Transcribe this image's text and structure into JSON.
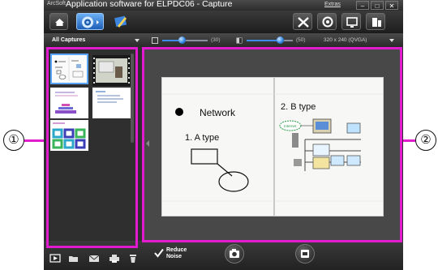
{
  "titlebar": {
    "brand": "ArcSoft",
    "title": "Application software for ELPDC06 - Capture",
    "extras": "Extras",
    "minimize": "–",
    "restore": "□",
    "close": "✕"
  },
  "toolbar": {
    "buttons": [
      "home-icon",
      "camera-capture-mode-icon",
      "annotate-icon",
      "settings-tools-icon",
      "camera-detect-icon",
      "display-icon",
      "freeze-icon"
    ]
  },
  "controls": {
    "filter_label": "All Captures",
    "brightness_value": "(30)",
    "contrast_value": "(50)",
    "resolution": "320 x 240 (QVGA)",
    "brightness": 0.3,
    "contrast": 0.5
  },
  "slide": {
    "bullet_text": "Network",
    "left_heading": "1. A type",
    "right_heading": "2. B type",
    "cloud_label": "Internet"
  },
  "bottom": {
    "reduce_noise_label_1": "Reduce",
    "reduce_noise_label_2": "Noise",
    "icons": [
      "slideshow-icon",
      "open-folder-icon",
      "email-icon",
      "print-icon",
      "delete-icon"
    ]
  },
  "annotations": {
    "left_callout": "①",
    "right_callout": "②",
    "color": "#e21ad0"
  }
}
